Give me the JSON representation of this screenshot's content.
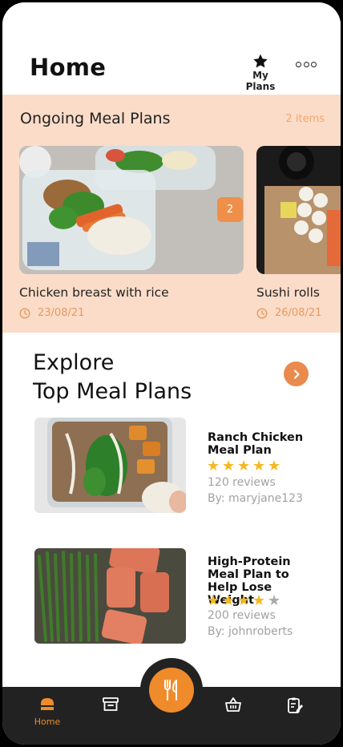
{
  "header": {
    "title": "Home",
    "my_plans_label": "My Plans",
    "icons": [
      "star-icon",
      "more-icon"
    ]
  },
  "ongoing": {
    "title": "Ongoing Meal Plans",
    "count": "2 items",
    "badge": "2",
    "cards": [
      {
        "name": "Chicken breast with rice",
        "date": "23/08/21",
        "image": "chicken-rice-meal-prep"
      },
      {
        "name": "Sushi rolls",
        "date": "26/08/21",
        "image": "sushi-rolls-box"
      }
    ]
  },
  "explore": {
    "title_line1": "Explore",
    "title_line2": "Top Meal Plans",
    "plans": [
      {
        "title": "Ranch Chicken Meal Plan",
        "rating": 5,
        "reviews": "120 reviews",
        "author": "By: maryjane123",
        "image": "ranch-chicken-tray"
      },
      {
        "title": "High-Protein Meal Plan to Help Lose Weight",
        "rating": 4,
        "reviews": "200 reviews",
        "author": "By: johnroberts",
        "image": "salmon-asparagus"
      }
    ]
  },
  "tabbar": {
    "active": "Home",
    "tabs": [
      {
        "label": "Home",
        "icon": "home-icon"
      },
      {
        "label": "",
        "icon": "archive-icon"
      },
      {
        "label": "",
        "icon": "fork-knife-icon"
      },
      {
        "label": "",
        "icon": "basket-icon"
      },
      {
        "label": "",
        "icon": "notes-icon"
      }
    ]
  },
  "colors": {
    "accent": "#F08B2C",
    "band": "#FBDCC8",
    "star": "#F5B820",
    "tabbar": "#222222"
  }
}
